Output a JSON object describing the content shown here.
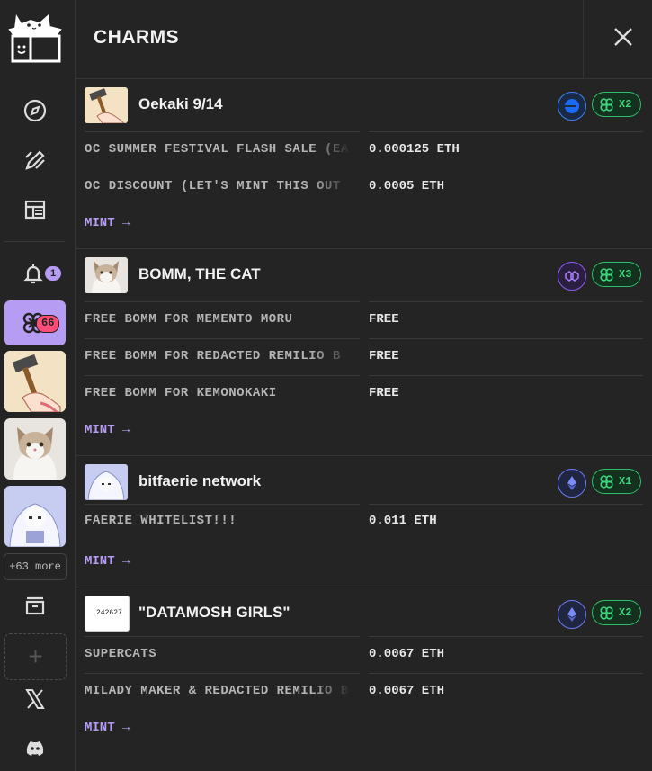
{
  "header": {
    "title": "CHARMS"
  },
  "sidebar": {
    "bell_count": "1",
    "charm_count": "66",
    "more_label": "+63 more"
  },
  "colors": {
    "accent": "#b69cf2",
    "green": "#3ed57a",
    "pink": "#ff4d78"
  },
  "projects": [
    {
      "name": "Oekaki 9/14",
      "chain": "base-icon",
      "multiplier": "X2",
      "rows": [
        {
          "name": "OC SUMMER FESTIVAL FLASH SALE (EA",
          "price": "0.000125 ETH"
        },
        {
          "name": "OC DISCOUNT (LET'S MINT THIS OUT",
          "price": "0.0005 ETH"
        }
      ],
      "mint_label": "MINT →"
    },
    {
      "name": "BOMM, THE CAT",
      "chain": "polygon-icon",
      "multiplier": "X3",
      "rows": [
        {
          "name": "FREE BOMM FOR MEMENTO MORU",
          "price": "FREE"
        },
        {
          "name": "FREE BOMM FOR REDACTED REMILIO B",
          "price": "FREE"
        },
        {
          "name": "FREE BOMM FOR KEMONOKAKI",
          "price": "FREE"
        }
      ],
      "mint_label": "MINT →"
    },
    {
      "name": "bitfaerie network",
      "chain": "ethereum-icon",
      "multiplier": "X1",
      "rows": [
        {
          "name": "FAERIE WHITELIST!!!",
          "price": "0.011 ETH"
        }
      ],
      "mint_label": "MINT →"
    },
    {
      "name": "\"DATAMOSH GIRLS\"",
      "chain": "ethereum-icon",
      "multiplier": "X2",
      "logo_text": ".242627",
      "rows": [
        {
          "name": "SUPERCATS",
          "price": "0.0067 ETH"
        },
        {
          "name": "MILADY MAKER & REDACTED REMILIO B",
          "price": "0.0067 ETH"
        }
      ],
      "mint_label": "MINT →"
    }
  ]
}
